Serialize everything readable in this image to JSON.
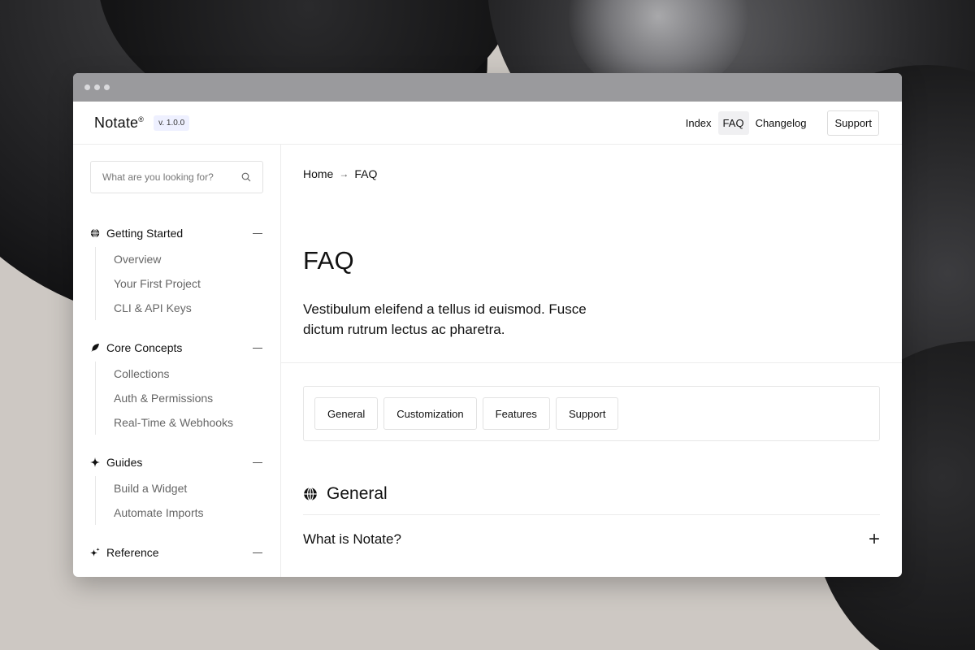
{
  "app": {
    "name": "Notate",
    "mark": "®",
    "version": "v. 1.0.0"
  },
  "topnav": {
    "links": [
      {
        "label": "Index"
      },
      {
        "label": "FAQ",
        "active": true
      },
      {
        "label": "Changelog"
      }
    ],
    "support_label": "Support"
  },
  "search": {
    "placeholder": "What are you looking for?",
    "icon": "search-icon"
  },
  "sidebar": {
    "sections": [
      {
        "title": "Getting Started",
        "icon": "globe-icon",
        "items": [
          "Overview",
          "Your First Project",
          "CLI & API Keys"
        ]
      },
      {
        "title": "Core Concepts",
        "icon": "leaf-icon",
        "items": [
          "Collections",
          "Auth & Permissions",
          "Real-Time & Webhooks"
        ]
      },
      {
        "title": "Guides",
        "icon": "sparkle-icon",
        "items": [
          "Build a Widget",
          "Automate Imports"
        ]
      },
      {
        "title": "Reference",
        "icon": "sparkles-icon",
        "items": []
      }
    ]
  },
  "breadcrumb": {
    "home": "Home",
    "current": "FAQ"
  },
  "page": {
    "title": "FAQ",
    "intro": "Vestibulum eleifend a tellus id euismod. Fusce dictum rutrum lectus ac pharetra."
  },
  "tabs": [
    "General",
    "Customization",
    "Features",
    "Support"
  ],
  "category": {
    "title": "General",
    "icon": "globe-icon"
  },
  "questions": [
    {
      "text": "What is Notate?",
      "toggle": "+"
    }
  ],
  "colors": {
    "version_badge_bg": "#eef0ff",
    "active_nav_bg": "#f0f0f2"
  }
}
